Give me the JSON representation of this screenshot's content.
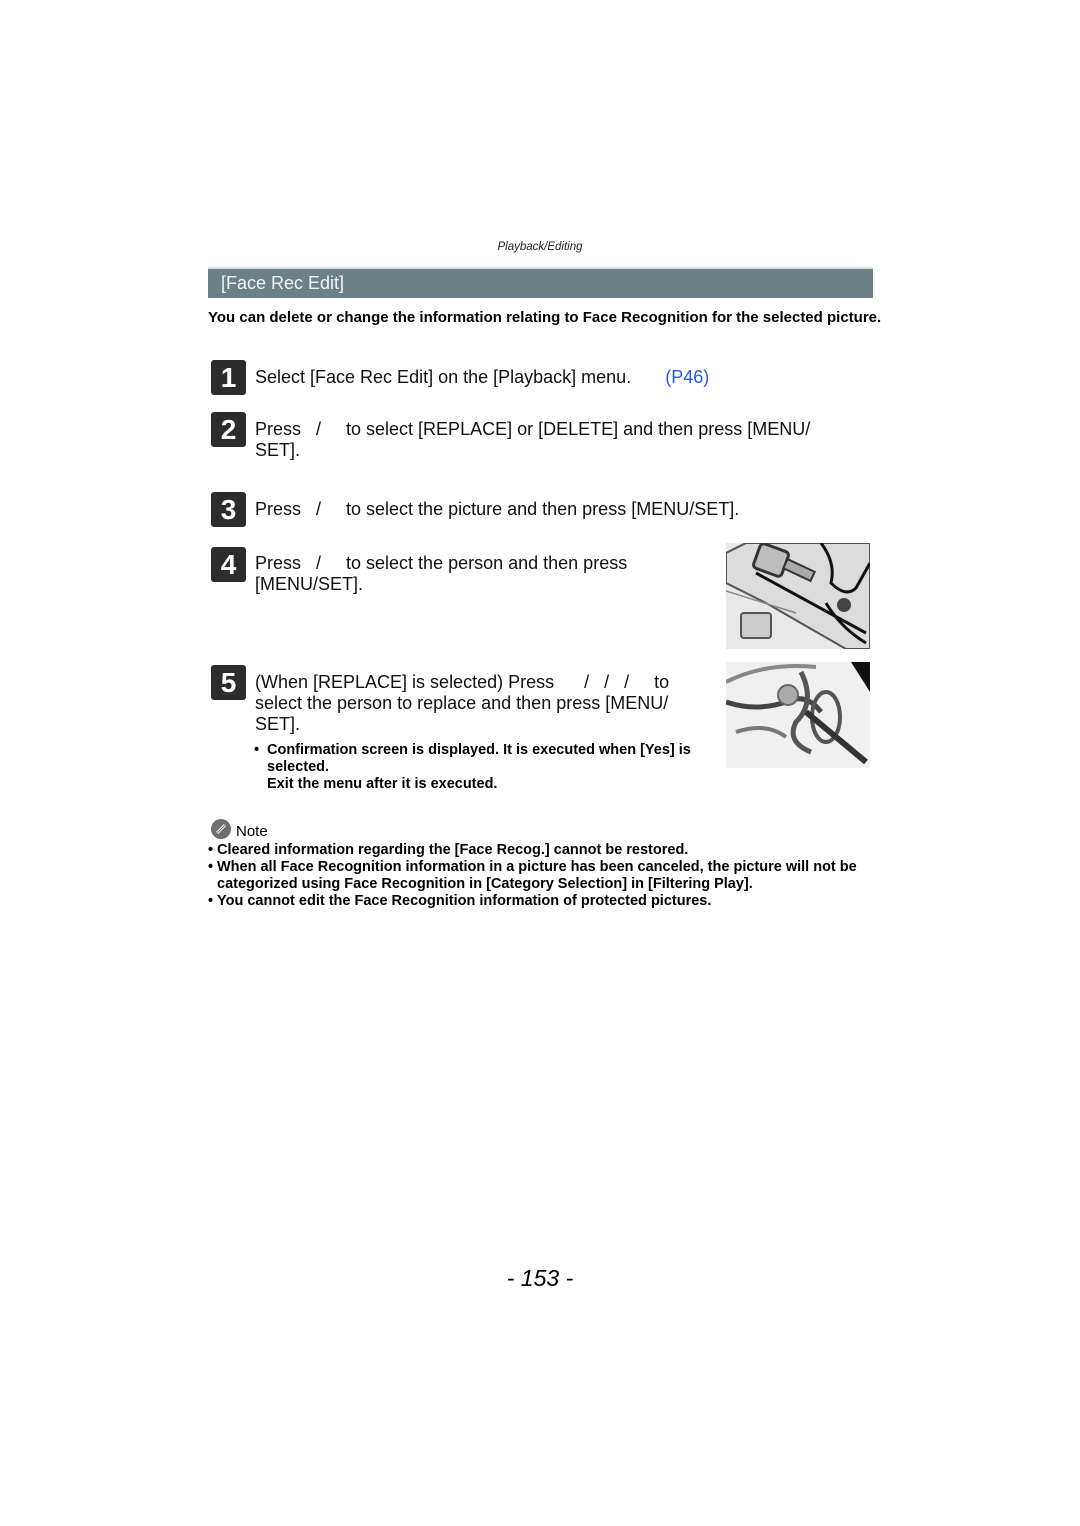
{
  "header": {
    "section": "Playback/Editing"
  },
  "title": "[Face Rec Edit]",
  "intro": "You can delete or change the information relating to Face Recognition for the selected picture.",
  "steps": [
    {
      "num": "1",
      "text": "Select [Face Rec Edit] on the [Playback] menu.",
      "ref": "(P46)"
    },
    {
      "num": "2",
      "line1": "Press   /     to select [REPLACE] or [DELETE] and then press [MENU/",
      "line2": "SET]."
    },
    {
      "num": "3",
      "text": "Press   /     to select the picture and then press [MENU/SET]."
    },
    {
      "num": "4",
      "line1": "Press   /     to select the person and then press",
      "line2": "[MENU/SET]."
    },
    {
      "num": "5",
      "line1": "(When [REPLACE] is selected) Press      /   /   /     to",
      "line2": "select the person to replace and then press [MENU/",
      "line3": "SET].",
      "bullet": "Confirmation screen is displayed. It is executed when [Yes] is selected.",
      "bullet_line1": "Confirmation screen is displayed. It is executed when [Yes] is",
      "bullet_line2": "selected.",
      "bullet_line3": "Exit the menu after it is executed."
    }
  ],
  "illustrations": [
    {
      "icon": "camera-back-closeup-illustration"
    },
    {
      "icon": "camera-dial-closeup-illustration"
    }
  ],
  "note": {
    "label": "Note",
    "items": [
      {
        "text": "Cleared information regarding the [Face Recog.] cannot be restored."
      },
      {
        "line1": "When all Face Recognition information in a picture has been canceled, the picture will not be",
        "line2": "categorized using Face Recognition in [Category Selection] in [Filtering Play]."
      },
      {
        "text": "You cannot edit the Face Recognition information of protected pictures."
      }
    ],
    "bullet": "•"
  },
  "page_number": "- 153 -"
}
